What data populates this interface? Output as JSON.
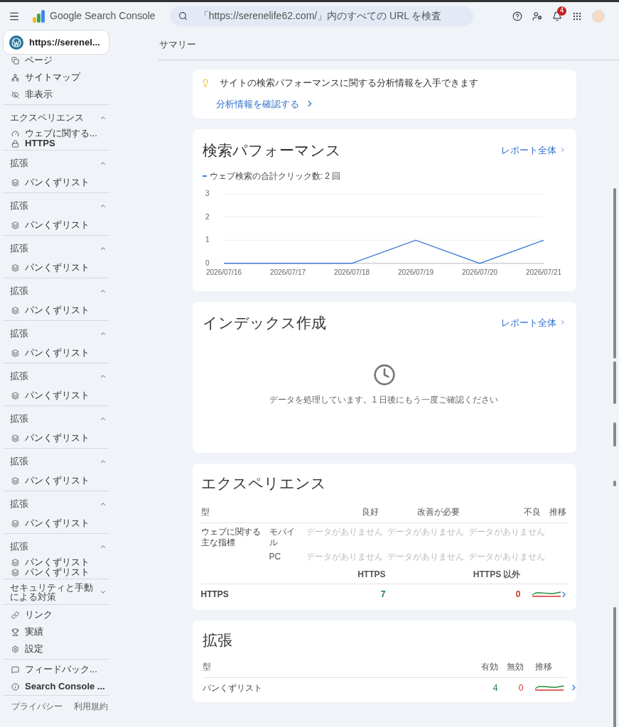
{
  "topbar": {
    "product": "Google Search Console",
    "search": {
      "placeholder": "「https://serenelife62.com/」内のすべての URL を検査"
    },
    "notification_count": "4"
  },
  "sidebar": {
    "property": "https://serenel...",
    "groups": [
      {
        "items": [
          {
            "label": "ページ",
            "kind": "page"
          },
          {
            "label": "サイトマップ",
            "kind": "sitemap"
          },
          {
            "label": "非表示",
            "kind": "hidden"
          }
        ]
      },
      {
        "title": "エクスペリエンス",
        "expanded": true,
        "items": [
          {
            "label": "ウェブに関する...",
            "kind": "gauge"
          },
          {
            "label": "HTTPS",
            "kind": "lock"
          }
        ]
      },
      {
        "title": "拡張",
        "expanded": true,
        "items": [
          {
            "label": "パンくずリスト",
            "kind": "layers"
          }
        ]
      },
      {
        "title": "拡張",
        "expanded": true,
        "items": [
          {
            "label": "パンくずリスト",
            "kind": "layers"
          }
        ]
      },
      {
        "title": "拡張",
        "expanded": true,
        "items": [
          {
            "label": "パンくずリスト",
            "kind": "layers"
          }
        ]
      },
      {
        "title": "拡張",
        "expanded": true,
        "items": [
          {
            "label": "パンくずリスト",
            "kind": "layers"
          }
        ]
      },
      {
        "title": "拡張",
        "expanded": true,
        "items": [
          {
            "label": "パンくずリスト",
            "kind": "layers"
          }
        ]
      },
      {
        "title": "拡張",
        "expanded": true,
        "items": [
          {
            "label": "パンくずリスト",
            "kind": "layers"
          }
        ]
      },
      {
        "title": "拡張",
        "expanded": true,
        "items": [
          {
            "label": "パンくずリスト",
            "kind": "layers"
          }
        ]
      },
      {
        "title": "拡張",
        "expanded": true,
        "items": [
          {
            "label": "パンくずリスト",
            "kind": "layers"
          }
        ]
      },
      {
        "title": "拡張",
        "expanded": true,
        "items": [
          {
            "label": "パンくずリスト",
            "kind": "layers"
          }
        ]
      },
      {
        "title": "拡張",
        "expanded": true,
        "items": [
          {
            "label": "パンくずリスト",
            "kind": "layers"
          },
          {
            "label": "パンくずリスト",
            "kind": "layers"
          }
        ]
      },
      {
        "title": "セキュリティと手動による対策",
        "expanded": false
      },
      {
        "items": [
          {
            "label": "リンク",
            "kind": "link"
          },
          {
            "label": "実績",
            "kind": "trophy"
          },
          {
            "label": "設定",
            "kind": "settings"
          }
        ]
      },
      {
        "items": [
          {
            "label": "フィードバック...",
            "kind": "feedback"
          },
          {
            "label": "Search Console ...",
            "kind": "info"
          }
        ]
      }
    ],
    "footer": [
      "プライバシー",
      "利用規約"
    ]
  },
  "page_title": "サマリー",
  "insight": {
    "text": "サイトの検索パフォーマンスに関する分析情報を入手できます",
    "link": "分析情報を確認する"
  },
  "performance": {
    "title": "検索パフォーマンス",
    "report_link": "レポート全体",
    "chart_data": {
      "type": "line",
      "categories": [
        "2026/07/16",
        "2026/07/17",
        "2026/07/18",
        "2026/07/19",
        "2026/07/20",
        "2026/07/21"
      ],
      "yticks": [
        0,
        1,
        2,
        3
      ],
      "ylim": [
        0,
        3
      ],
      "series": [
        {
          "name": "ウェブ検索の合計クリック数: 2 回",
          "color": "#4a80d8",
          "values": [
            0,
            0,
            0,
            1,
            0,
            1
          ]
        }
      ]
    }
  },
  "indexing": {
    "title": "インデックス作成",
    "report_link": "レポート全体",
    "message": "データを処理しています。1 日後にもう一度ご確認ください"
  },
  "experience": {
    "title": "エクスペリエンス",
    "columns": [
      "型",
      "良好",
      "改善が必要",
      "不良",
      "推移"
    ],
    "vitals": {
      "label": "ウェブに関する主な指標",
      "rows": [
        {
          "device": "モバイル",
          "cells": [
            "データがありません",
            "データがありません",
            "データがありません"
          ]
        },
        {
          "device": "PC",
          "cells": [
            "データがありません",
            "データがありません",
            "データがありません"
          ]
        }
      ]
    },
    "https_columns": [
      "HTTPS",
      "HTTPS 以外"
    ],
    "https_row": {
      "label": "HTTPS",
      "good": "7",
      "bad": "0"
    }
  },
  "enhancements": {
    "title": "拡張",
    "columns": [
      "型",
      "有効",
      "無効",
      "推移"
    ],
    "rows": [
      {
        "label": "パンくずリスト",
        "valid": "4",
        "invalid": "0"
      }
    ]
  }
}
